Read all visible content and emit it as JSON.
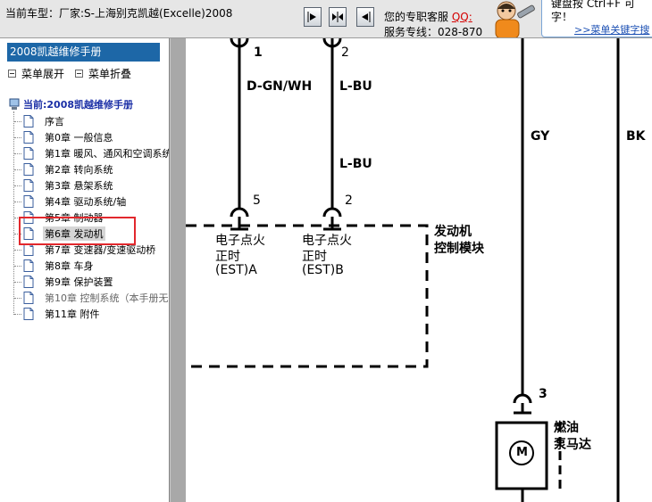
{
  "topbar": {
    "car_label": "当前车型：厂家:S-上海别克凯越(Excelle)2008",
    "nav_buttons": [
      "prev-page-icon",
      "fit-icon",
      "next-page-icon"
    ],
    "service_line1": "您的专职客服",
    "qq_label": "QQ:",
    "service_line2": "服务专线：028-870",
    "tip_line1": "键盘按   Ctrl+F   可",
    "tip_line2": "字！",
    "tip_link": ">>菜单关键字搜"
  },
  "sidebar": {
    "header": "2008凯越维修手册",
    "expand_label": "菜单展开",
    "collapse_label": "菜单折叠",
    "root_label": "当前:2008凯越维修手册",
    "items": [
      {
        "label": "序言"
      },
      {
        "label": "第0章 一般信息"
      },
      {
        "label": "第1章 暖风、通风和空调系统"
      },
      {
        "label": "第2章 转向系统"
      },
      {
        "label": "第3章 悬架系统"
      },
      {
        "label": "第4章 驱动系统/轴"
      },
      {
        "label": "第5章 制动器"
      },
      {
        "label": "第6章 发动机",
        "selected": true
      },
      {
        "label": "第7章 变速器/变速驱动桥"
      },
      {
        "label": "第8章 车身"
      },
      {
        "label": "第9章 保护装置"
      },
      {
        "label": "第10章 控制系统（本手册无",
        "dim": true
      },
      {
        "label": "第11章 附件"
      }
    ]
  },
  "diagram": {
    "pin1_top": "1",
    "pin2_top": "2",
    "wire1_color": "D-GN/WH",
    "wire2_color": "L-BU",
    "wire2_color_b": "L-BU",
    "gy_label": "GY",
    "bk_label": "BK",
    "pin5": "5",
    "pin2_bottom": "2",
    "ecm_line1": "发动机",
    "ecm_line2": "控制模块",
    "est_a_line1": "电子点火",
    "est_a_line2": "正时",
    "est_a_line3": "(EST)A",
    "est_b_line1": "电子点火",
    "est_b_line2": "正时",
    "est_b_line3": "(EST)B",
    "pin3": "3",
    "motor_symbol": "M",
    "pump_line1": "燃油",
    "pump_line2": "泵马达"
  }
}
